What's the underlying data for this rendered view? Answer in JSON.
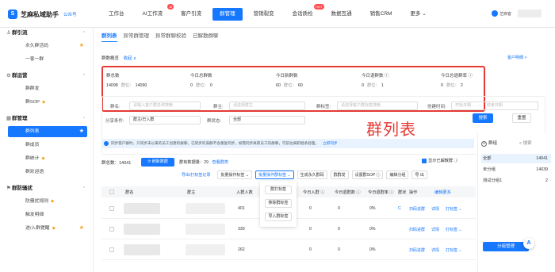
{
  "brand": {
    "logo_letter": "S",
    "name": "芝麻私域助手",
    "tag": "公众号"
  },
  "nav": [
    {
      "label": "工作台"
    },
    {
      "label": "AI工作流",
      "badge": "AI"
    },
    {
      "label": "客户引流"
    },
    {
      "label": "群管理",
      "active": true
    },
    {
      "label": "营销裂变"
    },
    {
      "label": "会话质检",
      "badge": "HOT"
    },
    {
      "label": "数据互通"
    },
    {
      "label": "销售CRM"
    },
    {
      "label": "更多 ⌄"
    }
  ],
  "user": {
    "name": "芝麻客"
  },
  "sidebar": {
    "groups": [
      {
        "icon": "⚓",
        "label": "群引流",
        "items": [
          {
            "label": "永久群活码",
            "star": true
          },
          {
            "label": "一客一群"
          }
        ]
      },
      {
        "icon": "⚙",
        "label": "群运营",
        "items": [
          {
            "label": "群群发"
          },
          {
            "label": "群SOP",
            "gem": true
          }
        ]
      },
      {
        "icon": "▦",
        "label": "群管理",
        "items": [
          {
            "label": "群列表",
            "active": true,
            "star": true
          },
          {
            "label": "群成员"
          },
          {
            "label": "群统计",
            "gem": true
          },
          {
            "label": "群欢迎语"
          }
        ]
      },
      {
        "icon": "⚑",
        "label": "群防骚扰",
        "items": [
          {
            "label": "防骚扰规则",
            "gem": true
          },
          {
            "label": "触发明细"
          },
          {
            "label": "进/入群提醒",
            "gem": true,
            "star": true
          }
        ]
      }
    ]
  },
  "tabs": [
    {
      "label": "群列表",
      "active": true
    },
    {
      "label": "异常群管理"
    },
    {
      "label": "异常群聊校验"
    },
    {
      "label": "已解散群聊"
    }
  ],
  "overview": {
    "title": "群数概览",
    "collapse": "收起 ∧",
    "more": "客户明细 >"
  },
  "stats": [
    {
      "label": "群总数",
      "main": "14098",
      "sub_label": "群位：",
      "sub_value": "14090"
    },
    {
      "label": "今日总群数",
      "main": "0",
      "sub_label": "群位：",
      "sub_value": "0"
    },
    {
      "label": "今日新群数",
      "main": "60",
      "sub_label": "群位：",
      "sub_value": "60"
    },
    {
      "label": "今日退群数 ⓘ",
      "main": "0",
      "sub_label": "群位：",
      "sub_value": "1"
    },
    {
      "label": "今日总退群率 ⓘ",
      "main": "0",
      "sub_label": "群位：",
      "sub_value": "2"
    }
  ],
  "filters": {
    "group_name_label": "群名:",
    "group_name_placeholder": "请输入客户群名称搜索",
    "owner_label": "群主:",
    "owner_placeholder": "请选择群主",
    "tag_label": "群标签:",
    "tag_placeholder": "请选择客户群标签搜索",
    "created_label": "创建时间:",
    "created_start": "开始日期",
    "created_end": "结束日期",
    "category_label": "分享条件:",
    "category_value": "群主/已入群",
    "status_label": "群状态:",
    "status_value": "全部",
    "search_label": "搜索",
    "reset_label": "重置"
  },
  "overlay_title": "群列表",
  "tip": {
    "text": "同步客户群时，只同步未以来的员工创建的群聊，已同步的旧群不会重复同步。如需同步离职员工的群聊，可前往离职继承处理。",
    "link": "立即同步"
  },
  "list_bar": {
    "count_label": "群总数：14041",
    "refresh_label": "刷新数据",
    "range_text": "群有数据量：29",
    "range_link": "查看群类",
    "checkbox_label": "显示已解散群 ⓘ"
  },
  "toolbar": [
    {
      "label": "导出/打标签记录",
      "style": "link"
    },
    {
      "label": "批量操作标签 ⌄"
    },
    {
      "label": "批量操作群标签 ⌄",
      "style": "blue-outline"
    },
    {
      "label": "生成永久群码"
    },
    {
      "label": "群群发"
    },
    {
      "label": "设置群SOP ⓘ"
    },
    {
      "label": "编辑分组"
    },
    {
      "label": "导 出"
    }
  ],
  "dropdown": [
    "群打标签",
    "移除群标签",
    "导入群标签"
  ],
  "table": {
    "headers": [
      "群名",
      "群主",
      "入群人数",
      "群标签",
      "今日入群 ⓘ",
      "今日退群数 ⓘ",
      "今日退群率 ⓘ",
      "群状",
      "操作",
      "编辑更多"
    ],
    "rows": [
      {
        "members": "401",
        "today_in": "0",
        "today_out": "0",
        "rate": "0%",
        "status": "C",
        "ops": [
          "扫码进群",
          "详情",
          "打标签 ⌄"
        ]
      },
      {
        "members": "330",
        "today_in": "0",
        "today_out": "0",
        "rate": "0%",
        "status": "",
        "ops": [
          "扫码进群",
          "详情",
          "打标签 ⌄"
        ]
      },
      {
        "members": "262",
        "today_in": "0",
        "today_out": "0",
        "rate": "0%",
        "status": "",
        "ops": [
          "扫码进群",
          "详情",
          "打标签 ⌄"
        ]
      }
    ]
  },
  "right_panel": {
    "title": "群组",
    "search": "搜索",
    "rows": [
      {
        "label": "全部",
        "count": "14041",
        "active": true
      },
      {
        "label": "未分组",
        "count": "14039"
      },
      {
        "label": "测试分组1",
        "count": "2"
      }
    ],
    "group_manage": "分组管理"
  },
  "float_button": "A"
}
